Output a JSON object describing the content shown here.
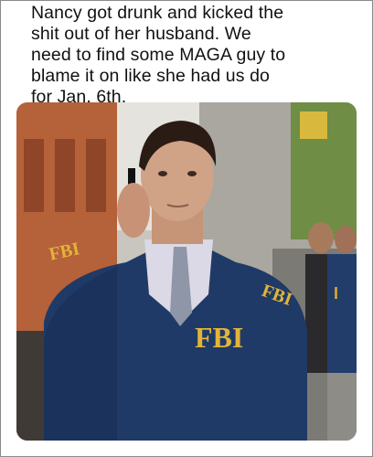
{
  "caption": {
    "lines": [
      "Nancy got drunk and kicked the",
      "shit out of her husband. We",
      "need to find some MAGA guy to",
      "blame it on like she had us do",
      "for Jan. 6th."
    ]
  },
  "photo": {
    "jacket_text": "FBI",
    "colors": {
      "jacket": "#1f3a66",
      "lettering": "#e2b43a",
      "building": "#b5613a",
      "foliage": "#6f8d45"
    }
  }
}
